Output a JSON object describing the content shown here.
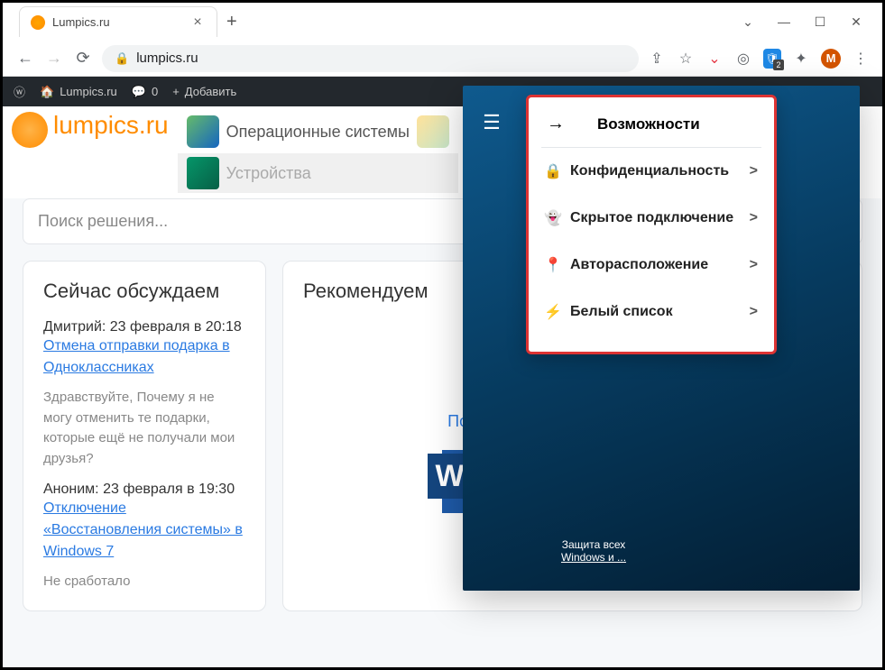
{
  "browser": {
    "tab_title": "Lumpics.ru",
    "url": "lumpics.ru",
    "shield_badge": "2",
    "avatar_letter": "M"
  },
  "wpbar": {
    "site": "Lumpics.ru",
    "comments": "0",
    "add": "Добавить"
  },
  "site": {
    "logo": "lumpics.ru",
    "nav_os": "Операционные системы",
    "nav_dev": "Устройства",
    "search_placeholder": "Поиск решения..."
  },
  "discuss": {
    "title": "Сейчас обсуждаем",
    "c1_who": "Дмитрий: 23 февраля в 20:18",
    "c1_link": "Отмена отправки подарка в Одноклассниках",
    "c1_body": "Здравствуйте, Почему я не могу отменить те подарки, которые ещё не получали мои друзья?",
    "c2_who": "Аноним: 23 февраля в 19:30",
    "c2_link": "Отключение «Восстановления системы» в Windows 7",
    "c2_body": "Не сработало"
  },
  "recommend": {
    "title": "Рекомендуем",
    "r1": "Поворачиваем текст в Фотошопе"
  },
  "popup": {
    "title": "Возможности",
    "rows": [
      {
        "label": "Конфиденциальность"
      },
      {
        "label": "Скрытое подключение"
      },
      {
        "label": "Авторасположение"
      },
      {
        "label": "Белый список"
      }
    ],
    "footer1": "Защита всех",
    "footer2": "Windows и ..."
  }
}
